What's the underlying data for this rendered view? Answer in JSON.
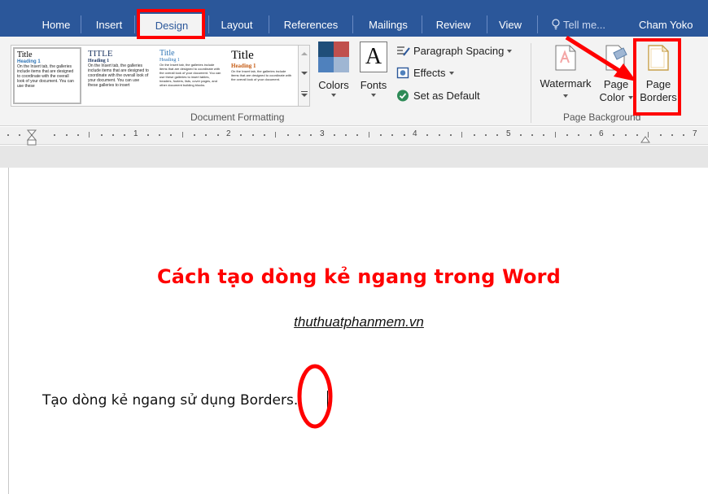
{
  "tabs": [
    "Home",
    "Insert",
    "Design",
    "Layout",
    "References",
    "Mailings",
    "Review",
    "View"
  ],
  "active_tab": "Design",
  "tell_me": "Tell me...",
  "user_name": "Cham Yoko",
  "gallery": {
    "styles": [
      {
        "title": "Title",
        "heading": "Heading 1",
        "text": "On the Insert tab, the galleries include items that are designed to coordinate with the overall look of your document. You can use these"
      },
      {
        "title": "TITLE",
        "heading": "Heading 1",
        "text": "On the Insert tab, the galleries include items that are designed to coordinate with the overall look of your document. You can use these galleries to insert"
      },
      {
        "title": "Title",
        "heading": "Heading 1",
        "text": "On the Insert tab, the galleries include items that are designed to coordinate with the overall look of your document. You can use these galleries to insert tables, headers, footers, lists, cover pages, and other document building blocks."
      },
      {
        "title": "Title",
        "heading": "Heading 1",
        "text": "On the Insert tab, the galleries include items that are designed to coordinate with the overall look of your document."
      }
    ]
  },
  "colors_label": "Colors",
  "fonts_label": "Fonts",
  "fonts_glyph": "A",
  "paragraph_spacing_label": "Paragraph Spacing",
  "effects_label": "Effects",
  "set_default_label": "Set as Default",
  "document_formatting_label": "Document Formatting",
  "watermark_label": "Watermark",
  "page_color_line1": "Page",
  "page_color_line2": "Color",
  "page_borders_line1": "Page",
  "page_borders_line2": "Borders",
  "page_background_label": "Page Background",
  "ruler_numbers": [
    "1",
    "2",
    "3",
    "4",
    "5",
    "6",
    "7"
  ],
  "document": {
    "title": "Cách tạo dòng kẻ ngang trong Word",
    "subtitle": "thuthuatphanmem.vn",
    "body": "Tạo  dòng kẻ ngang sử dụng Borders."
  },
  "colors": {
    "brand": "#2b579a",
    "highlight": "#ff0000"
  }
}
